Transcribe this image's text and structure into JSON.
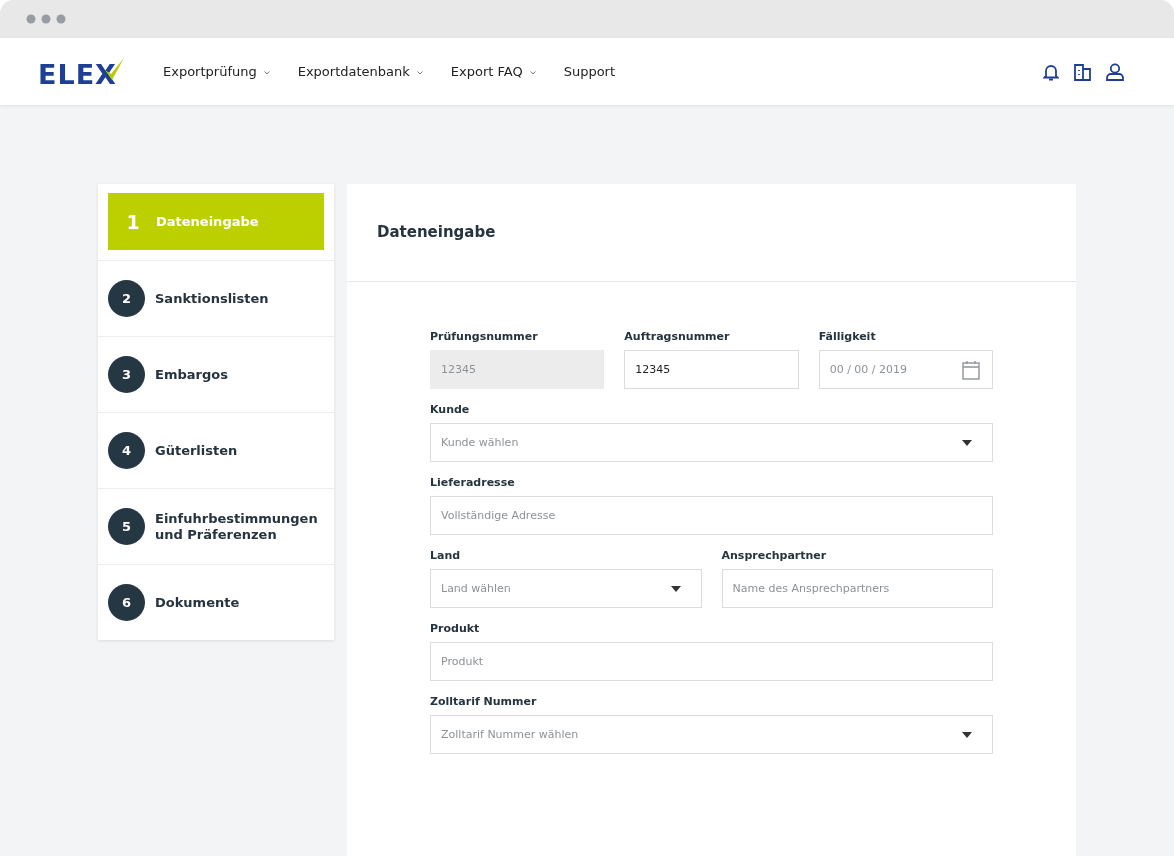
{
  "logo": {
    "text": "ELEX"
  },
  "nav": [
    {
      "label": "Exportprüfung",
      "dropdown": true
    },
    {
      "label": "Exportdatenbank",
      "dropdown": true
    },
    {
      "label": "Export FAQ",
      "dropdown": true
    },
    {
      "label": "Support",
      "dropdown": false
    }
  ],
  "steps": [
    {
      "number": "1",
      "label": "Dateneingabe",
      "selected": true
    },
    {
      "number": "2",
      "label": "Sanktionslisten",
      "selected": false
    },
    {
      "number": "3",
      "label": "Embargos",
      "selected": false
    },
    {
      "number": "4",
      "label": "Güterlisten",
      "selected": false
    },
    {
      "number": "5",
      "label": "Einfuhrbestimmungen und Präferenzen",
      "selected": false
    },
    {
      "number": "6",
      "label": "Dokumente",
      "selected": false
    }
  ],
  "form": {
    "title": "Dateneingabe",
    "rows": [
      {
        "fields": [
          {
            "label": "Prüfungsnummer",
            "kind": "text",
            "value": "12345",
            "disabled": true
          },
          {
            "label": "Auftragsnummer",
            "kind": "text",
            "value": "12345",
            "disabled": false
          },
          {
            "label": "Fälligkeit",
            "kind": "date",
            "placeholder": "00 / 00 / 2019",
            "disabled": false
          }
        ]
      },
      {
        "fields": [
          {
            "label": "Kunde",
            "kind": "select",
            "placeholder": "Kunde wählen",
            "disabled": false
          }
        ]
      },
      {
        "fields": [
          {
            "label": "Lieferadresse",
            "kind": "text",
            "placeholder": "Vollständige Adresse",
            "disabled": false
          }
        ]
      },
      {
        "fields": [
          {
            "label": "Land",
            "kind": "select",
            "placeholder": "Land wählen",
            "disabled": false
          },
          {
            "label": "Ansprechpartner",
            "kind": "text",
            "placeholder": "Name des Ansprechpartners",
            "disabled": false
          }
        ]
      },
      {
        "fields": [
          {
            "label": "Produkt",
            "kind": "text",
            "placeholder": "Produkt",
            "disabled": false
          }
        ]
      },
      {
        "fields": [
          {
            "label": "Zolltarif Nummer",
            "kind": "select",
            "placeholder": "Zolltarif Nummer wählen",
            "disabled": false
          }
        ]
      }
    ]
  }
}
